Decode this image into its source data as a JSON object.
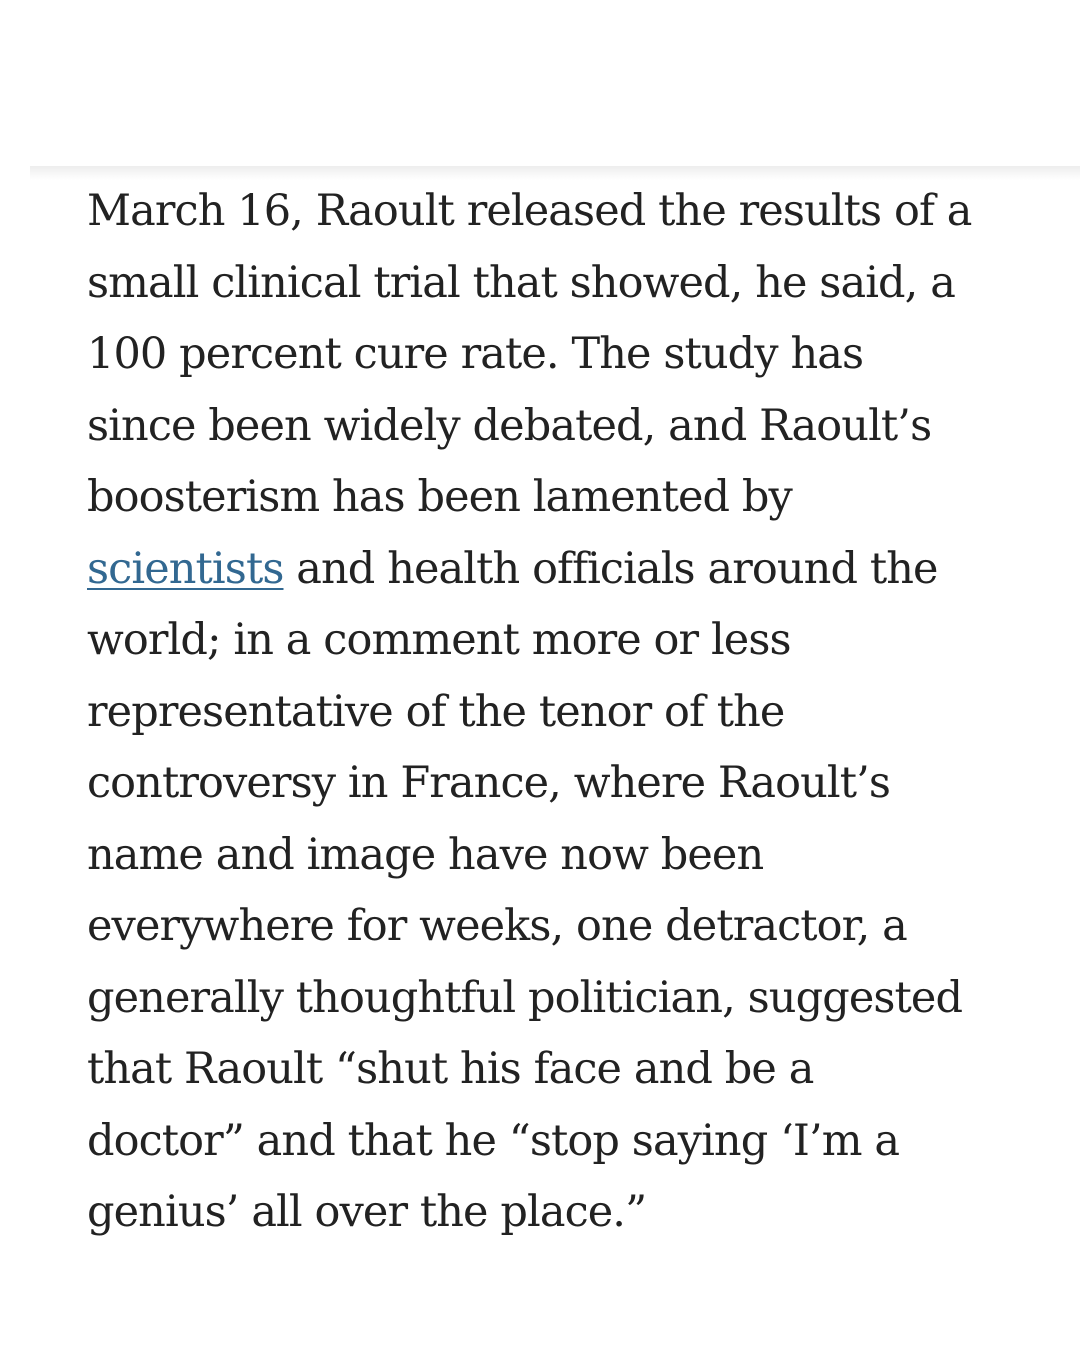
{
  "article": {
    "paragraph": {
      "lines": [
        {
          "text": "March 16, Raoult released the results of a"
        },
        {
          "text": "small clinical trial that showed, he said, a"
        },
        {
          "text": "100 percent cure rate. The study has"
        },
        {
          "text": "since been widely debated, and Raoult’s"
        },
        {
          "text": "boosterism has been lamented by"
        },
        {
          "link": "scientists",
          "text": " and health officials around the"
        },
        {
          "text": "world; in a comment more or less"
        },
        {
          "text": "representative of the tenor of the"
        },
        {
          "text": "controversy in France, where Raoult’s"
        },
        {
          "text": "name and image have now been"
        },
        {
          "text": "everywhere for weeks, one detractor, a"
        },
        {
          "text": "generally thoughtful politician, suggested"
        },
        {
          "text": "that Raoult “shut his face and be a"
        },
        {
          "text": "doctor” and that he “stop saying ‘I’m a"
        },
        {
          "text": "genius’ all over the place.”"
        }
      ]
    }
  },
  "colors": {
    "text": "#222222",
    "link": "#326891",
    "background": "#ffffff"
  }
}
